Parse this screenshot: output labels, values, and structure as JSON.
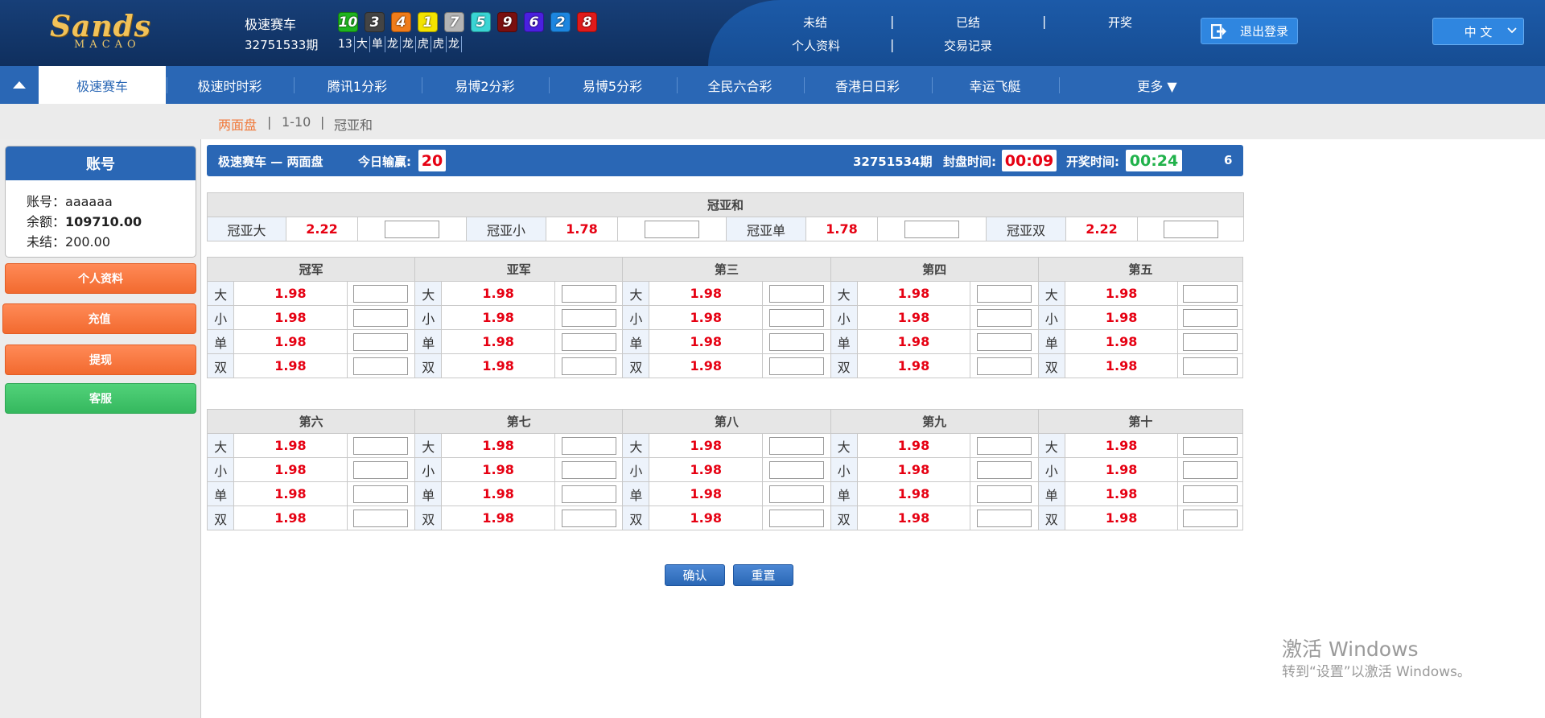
{
  "header": {
    "logo_main": "Sands",
    "logo_sub": "MACAO",
    "game": "极速赛车",
    "period": "32751533期",
    "balls": [
      {
        "n": "10",
        "color": "#1fb51f"
      },
      {
        "n": "3",
        "color": "#444444"
      },
      {
        "n": "4",
        "color": "#f07c1a"
      },
      {
        "n": "1",
        "color": "#f3e300"
      },
      {
        "n": "7",
        "color": "#b4b4b4"
      },
      {
        "n": "5",
        "color": "#39d4d4"
      },
      {
        "n": "9",
        "color": "#7a0f0f"
      },
      {
        "n": "6",
        "color": "#4a20e0"
      },
      {
        "n": "2",
        "color": "#1c86e0"
      },
      {
        "n": "8",
        "color": "#e01a1a"
      }
    ],
    "stats": [
      "13",
      "大",
      "单",
      "龙",
      "龙",
      "虎",
      "虎",
      "龙"
    ],
    "links": {
      "unsettled": "未结",
      "settled": "已结",
      "draw": "开奖",
      "profile": "个人资料",
      "records": "交易记录",
      "sep": "|"
    },
    "logout": "退出登录",
    "lang": "中 文"
  },
  "nav": {
    "items": [
      "极速赛车",
      "极速时时彩",
      "腾讯1分彩",
      "易博2分彩",
      "易博5分彩",
      "全民六合彩",
      "香港日日彩",
      "幸运飞艇"
    ],
    "more": "更多  ▼"
  },
  "subtabs": {
    "t1": "两面盘",
    "sep": "|",
    "t2": "1-10",
    "t3": "冠亚和"
  },
  "account": {
    "title": "账号",
    "username_label": "账号：",
    "username": "aaaaaa",
    "balance_label": "余额：",
    "balance": "109710.00",
    "unsettled_label": "未结：",
    "unsettled": "200.00",
    "buttons": {
      "profile": "个人资料",
      "deposit": "充值",
      "withdraw": "提现",
      "service": "客服"
    }
  },
  "bar": {
    "title": "极速赛车 — 两面盘",
    "today_label": "今日输赢:",
    "today_value": "20",
    "next_period": "32751534期",
    "close_label": "封盘时间:",
    "close_time": "00:09",
    "draw_label": "开奖时间:",
    "draw_time": "00:24",
    "count": "6"
  },
  "champion_sum": {
    "title": "冠亚和",
    "items": [
      {
        "label": "冠亚大",
        "odds": "2.22"
      },
      {
        "label": "冠亚小",
        "odds": "1.78"
      },
      {
        "label": "冠亚单",
        "odds": "1.78"
      },
      {
        "label": "冠亚双",
        "odds": "2.22"
      }
    ]
  },
  "positions_top": [
    "冠军",
    "亚军",
    "第三",
    "第四",
    "第五"
  ],
  "positions_bottom": [
    "第六",
    "第七",
    "第八",
    "第九",
    "第十"
  ],
  "bet_types": [
    "大",
    "小",
    "单",
    "双"
  ],
  "odds": "1.98",
  "actions": {
    "confirm": "确认",
    "reset": "重置"
  },
  "watermark": {
    "line1": "激活 Windows",
    "line2": "转到“设置”以激活 Windows。"
  }
}
